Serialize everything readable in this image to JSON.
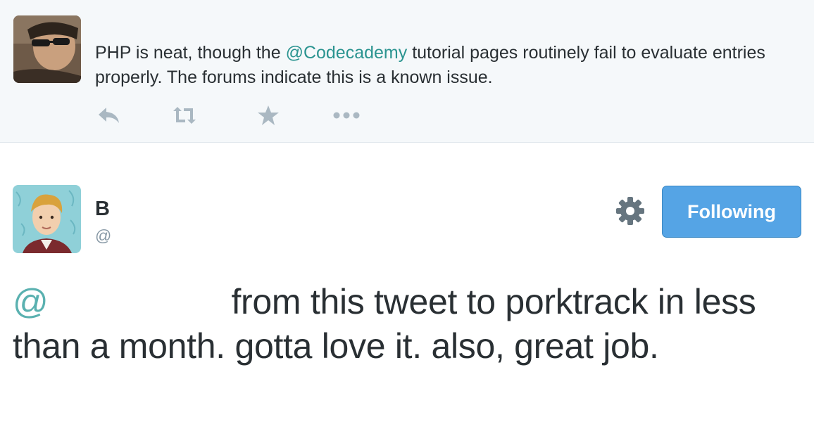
{
  "reply_context": {
    "text_before": "PHP is neat, though the ",
    "mention": "@Codecademy",
    "text_after": " tutorial pages routinely fail to evaluate entries properly. The forums indicate this is a known issue.",
    "actions": [
      {
        "name": "reply-icon"
      },
      {
        "name": "retweet-icon"
      },
      {
        "name": "favorite-icon"
      },
      {
        "name": "more-icon"
      }
    ]
  },
  "tweet": {
    "author_name": "B",
    "author_handle": "@",
    "follow_label": "Following",
    "mention": "@",
    "text": "from this tweet to porktrack in less than a month. gotta love it. also, great job."
  },
  "colors": {
    "accent": "#2b9490",
    "button": "#55a4e5",
    "context_bg": "#f5f8fa",
    "icon": "#aab8c2"
  }
}
